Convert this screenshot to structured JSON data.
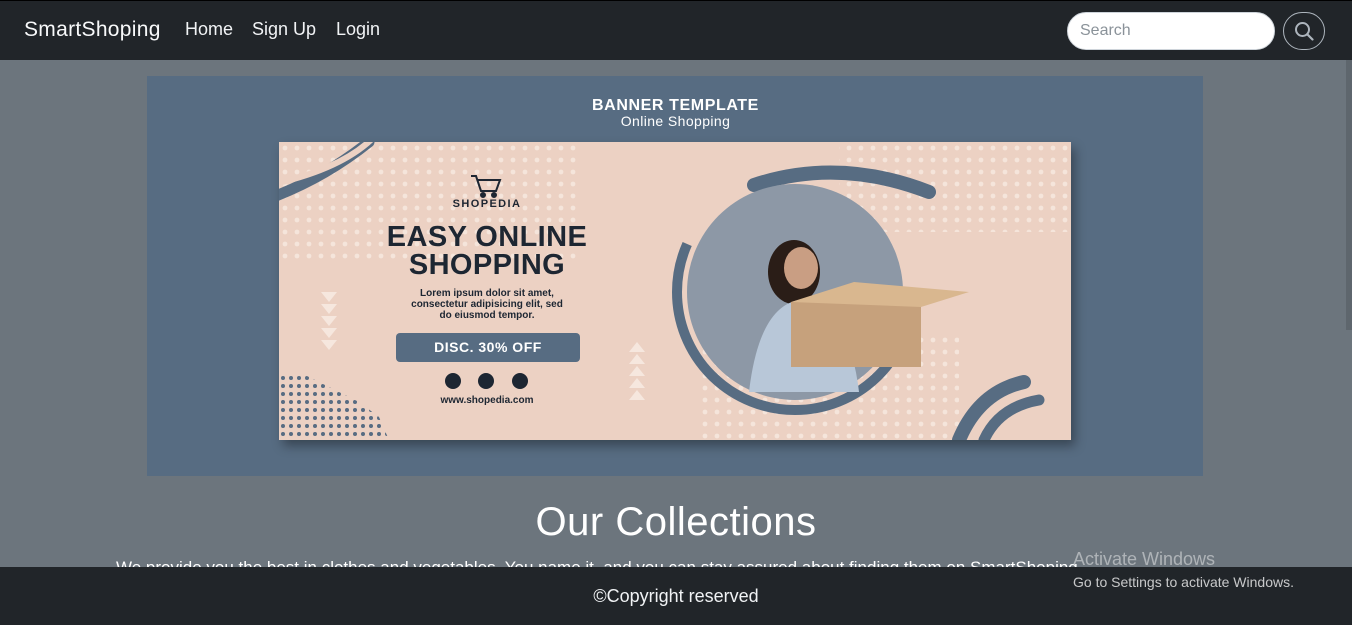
{
  "navbar": {
    "brand": "SmartShoping",
    "links": [
      "Home",
      "Sign Up",
      "Login"
    ],
    "search_placeholder": "Search",
    "search_icon": "magnifier-icon"
  },
  "banner": {
    "title": "BANNER TEMPLATE",
    "subtitle": "Online Shopping",
    "brand": "SHOPEDIA",
    "headline_line1": "EASY ONLINE",
    "headline_line2": "SHOPPING",
    "body_line1": "Lorem ipsum dolor sit amet,",
    "body_line2": "consectetur adipisicing elit, sed",
    "body_line3": "do eiusmod tempor.",
    "discount": "DISC. 30% OFF",
    "website": "www.shopedia.com",
    "social_icons": [
      "instagram-icon",
      "facebook-icon",
      "twitter-icon"
    ],
    "colors": {
      "background": "#576c82",
      "card": "#ecd1c3",
      "text": "#1d2632"
    }
  },
  "collections": {
    "title": "Our Collections",
    "text": "We provide you the best in clothes and vegetables. You name it, and you can stay assured about finding them on SmartShoping."
  },
  "footer": {
    "copyright": "©Copyright reserved"
  },
  "watermark": {
    "title": "Activate Windows",
    "subtitle": "Go to Settings to activate Windows."
  },
  "colors": {
    "navbar": "#212529",
    "page": "#6c757d"
  }
}
